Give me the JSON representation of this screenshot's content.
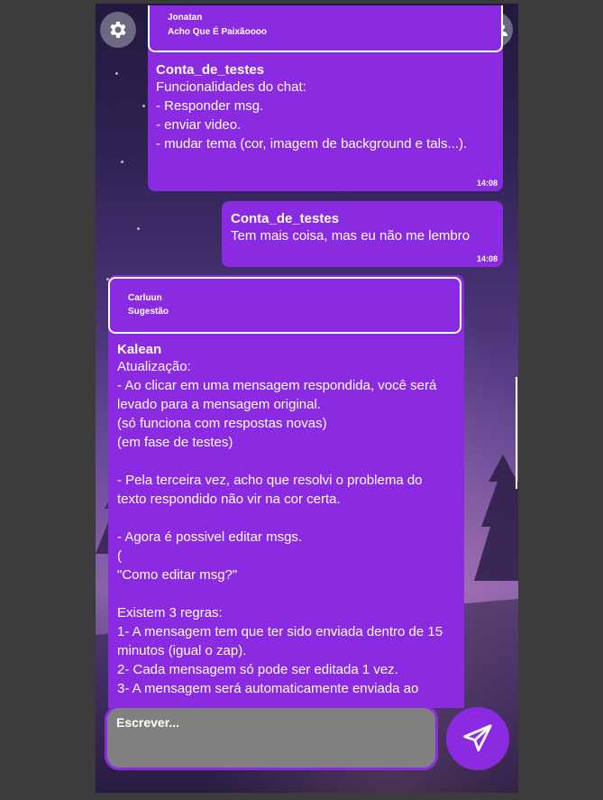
{
  "header": {
    "settings_icon": "gear-icon",
    "group_icon": "users-icon"
  },
  "messages": [
    {
      "reply": {
        "author": "Jonatan",
        "text": "Acho Que É Paixãoooo"
      },
      "sender": "Conta_de_testes",
      "text": "Funcionalidades do chat:\n- Responder msg.\n- enviar video.\n- mudar tema (cor, imagem de background e tals...).",
      "time": "14:08"
    },
    {
      "sender": "Conta_de_testes",
      "text": "Tem mais coisa, mas eu não me lembro",
      "time": "14:08"
    },
    {
      "reply": {
        "author": "Carluun",
        "text": "Sugestão"
      },
      "sender": "Kalean",
      "text": "Atualização:\n- Ao clicar em uma mensagem respondida, você será levado para a mensagem original.\n(só funciona com respostas novas)\n(em fase de testes)\n\n- Pela terceira vez, acho que resolvi o problema do texto respondido não vir na cor certa.\n\n- Agora é possivel editar msgs.\n(\n\"Como editar msg?\"\n\nExistem 3 regras:\n1- A mensagem tem que ter sido enviada dentro de 15 minutos (igual o zap).\n2- Cada mensagem só pode ser editada 1 vez.\n3- A mensagem será automaticamente enviada ao"
    }
  ],
  "composer": {
    "placeholder": "Escrever...",
    "send_icon": "send-icon"
  },
  "colors": {
    "accent": "#8a2be2",
    "input_bg": "#808080"
  }
}
